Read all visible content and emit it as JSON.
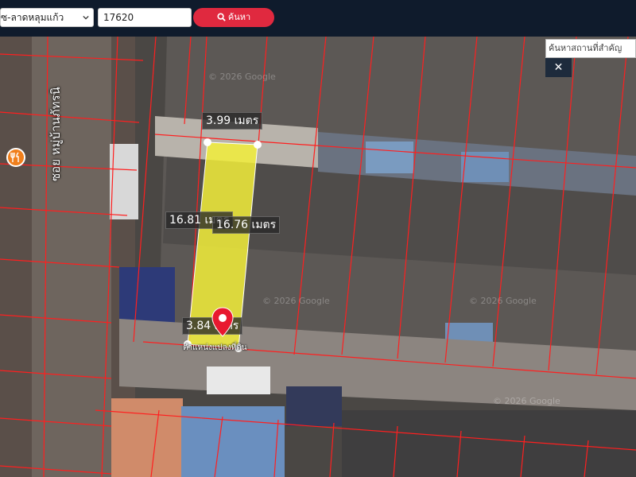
{
  "toolbar": {
    "district_select": "ซ-ลาดหลุมแก้ว",
    "code_value": "17620",
    "search_label": "ค้นหา"
  },
  "place_search": {
    "placeholder": "ค้นหาสถานที่สำคัญ"
  },
  "close_label": "✕",
  "measurements": {
    "top": "3.99 เมตร",
    "left": "16.81 เมตร",
    "right": "16.76 เมตร",
    "bottom": "3.84 เมตร"
  },
  "parcel_label": "ตำแหน่งแปลงที่ดิน",
  "street_label": "ซอย หมู่บ้านภัทรนิ",
  "watermark": "© 2026 Google",
  "colors": {
    "parcel_fill": "#f2ee3a",
    "boundary": "#ff1f1f",
    "pin": "#e8182f",
    "button": "#e0293f",
    "topbar": "#0f1b2c"
  }
}
